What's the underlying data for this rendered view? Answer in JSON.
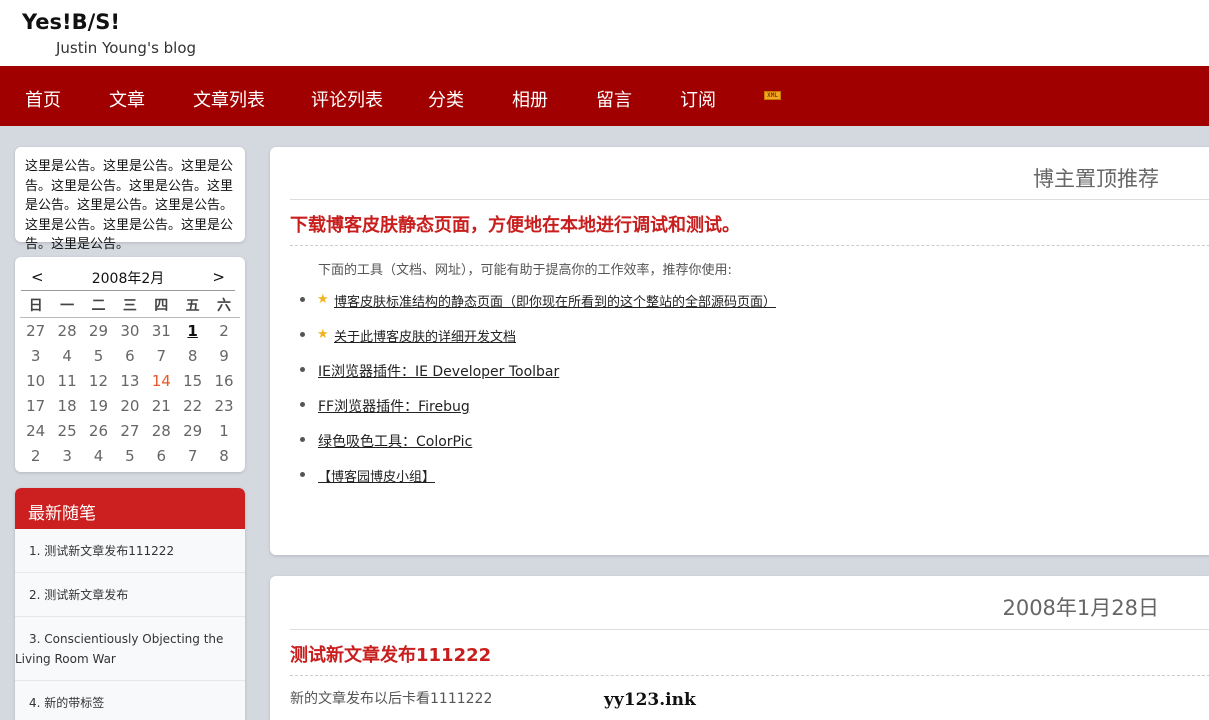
{
  "header": {
    "title": "Yes!B/S!",
    "subtitle": "Justin Young's blog"
  },
  "nav": {
    "items": [
      "首页",
      "文章",
      "文章列表",
      "评论列表",
      "分类",
      "相册",
      "留言",
      "订阅"
    ],
    "rss_badge": "XML"
  },
  "sidebar": {
    "notice": "这里是公告。这里是公告。这里是公告。这里是公告。这里是公告。这里是公告。这里是公告。这里是公告。这里是公告。这里是公告。这里是公告。这里是公告。",
    "calendar": {
      "prev": "<",
      "title": "2008年2月",
      "next": ">",
      "weekdays": [
        "日",
        "一",
        "二",
        "三",
        "四",
        "五",
        "六"
      ],
      "weeks": [
        [
          "27",
          "28",
          "29",
          "30",
          "31",
          "1",
          "2"
        ],
        [
          "3",
          "4",
          "5",
          "6",
          "7",
          "8",
          "9"
        ],
        [
          "10",
          "11",
          "12",
          "13",
          "14",
          "15",
          "16"
        ],
        [
          "17",
          "18",
          "19",
          "20",
          "21",
          "22",
          "23"
        ],
        [
          "24",
          "25",
          "26",
          "27",
          "28",
          "29",
          "1"
        ],
        [
          "2",
          "3",
          "4",
          "5",
          "6",
          "7",
          "8"
        ]
      ],
      "today": "1",
      "highlighted": "14"
    },
    "recent": {
      "heading": "最新随笔",
      "items": [
        "1. 测试新文章发布111222",
        "2. 测试新文章发布",
        "3. Conscientiously Objecting the Living Room War",
        "4. 新的带标签"
      ]
    }
  },
  "pinned": {
    "label": "博主置顶推荐",
    "title": "下载博客皮肤静态页面，方便地在本地进行调试和测试。",
    "intro": "下面的工具（文档、网址），可能有助于提高你的工作效率，推荐你使用:",
    "tools": [
      {
        "text": "博客皮肤标准结构的静态页面（即你现在所看到的这个整站的全部源码页面）",
        "starred": true
      },
      {
        "text": "关于此博客皮肤的详细开发文档",
        "starred": true
      },
      {
        "text": "IE浏览器插件：IE Developer Toolbar",
        "starred": false
      },
      {
        "text": "FF浏览器插件：Firebug",
        "starred": false
      },
      {
        "text": "绿色吸色工具：ColorPic",
        "starred": false
      },
      {
        "text": "【博客园博皮小组】",
        "starred": false
      }
    ]
  },
  "post": {
    "date": "2008年1月28日",
    "title": "测试新文章发布111222",
    "body": "新的文章发布以后卡看1111222"
  },
  "watermark": "yy123.ink",
  "colors": {
    "nav_bg": "#a10000",
    "accent_red": "#c81e1e",
    "page_bg": "#d4d8df",
    "today_highlight": "#e8572a",
    "star": "#f0b323"
  }
}
